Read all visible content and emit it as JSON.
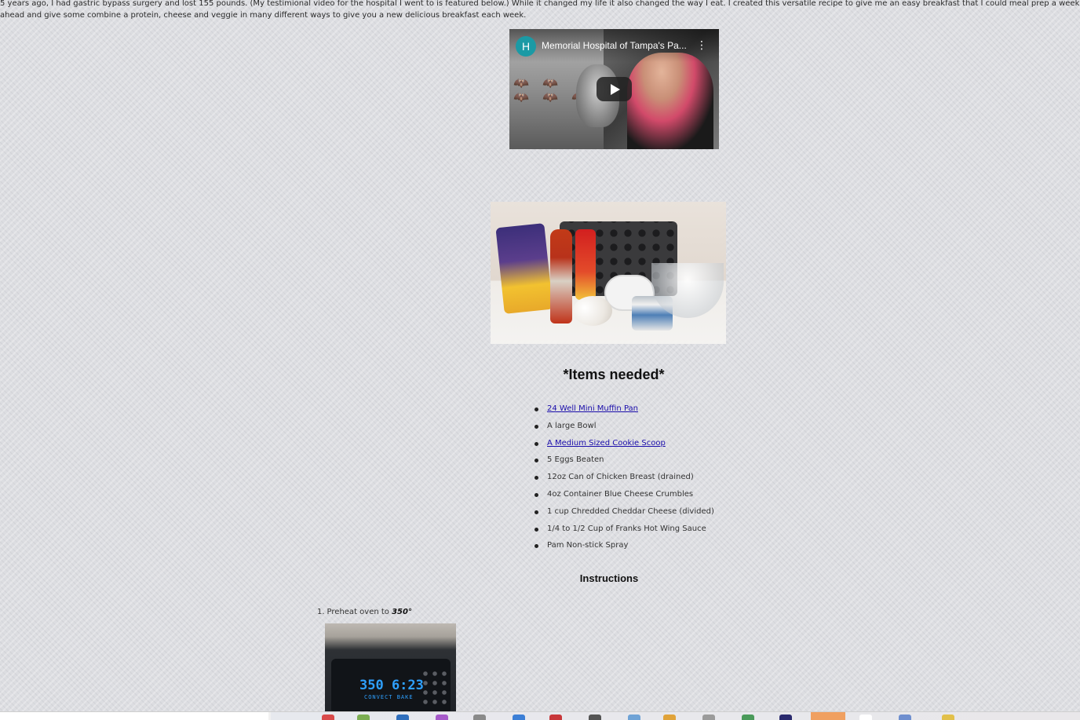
{
  "intro_text": "5 years ago, I had gastric bypass surgery and lost 155 pounds. (My testimional video for the hospital I went to is featured below.) While it changed my life it also changed the way I eat. I created this versatile recipe to give me an easy breakfast that I could meal prep a week ahead and give some combine a protein, cheese and veggie in many different ways to give you a new delicious breakfast each week.",
  "video": {
    "channel_initial": "H",
    "title": "Memorial Hospital of Tampa's Pa...",
    "icons": [
      "kebab-menu-icon",
      "play-icon"
    ]
  },
  "items_heading": "*Items needed*",
  "items": [
    {
      "text": "24 Well Mini Muffin Pan",
      "link": true
    },
    {
      "text": "A large Bowl",
      "link": false
    },
    {
      "text": "A Medium Sized Cookie Scoop",
      "link": true
    },
    {
      "text": "5 Eggs Beaten",
      "link": false
    },
    {
      "text": "12oz Can of Chicken Breast (drained)",
      "link": false
    },
    {
      "text": "4oz Container Blue Cheese Crumbles",
      "link": false
    },
    {
      "text": "1 cup Chredded Cheddar Cheese (divided)",
      "link": false
    },
    {
      "text": "1/4 to 1/2 Cup of Franks Hot Wing Sauce",
      "link": false
    },
    {
      "text": "Pam Non-stick Spray",
      "link": false
    }
  ],
  "instructions_heading": "Instructions",
  "steps": [
    {
      "num": "1.",
      "text": "Preheat oven to ",
      "temp": "350°"
    }
  ],
  "oven_display": {
    "main": "350 6:23",
    "sub": "CONVECT BAKE"
  },
  "colors": {
    "link": "#1a0dab",
    "channel_avatar": "#1b9aa5",
    "oven_display": "#2ea0ff"
  }
}
